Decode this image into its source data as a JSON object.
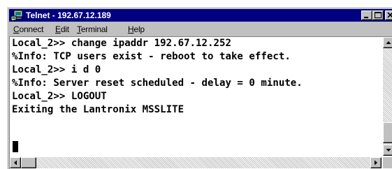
{
  "window": {
    "title": "Telnet - 192.67.12.189",
    "title_bar_color": "#000080",
    "terminal_background": "#ffffff",
    "icons": {
      "app": "telnet-computer-icon",
      "minimize": "minimize-icon",
      "maximize": "maximize-icon",
      "close": "close-icon"
    }
  },
  "menu": {
    "connect": {
      "accel": "C",
      "rest": "onnect"
    },
    "edit": {
      "accel": "E",
      "rest": "dit"
    },
    "terminal": {
      "accel": "T",
      "rest": "erminal"
    },
    "help": {
      "accel": "H",
      "rest": "elp"
    }
  },
  "terminal": {
    "lines": [
      "Local_2>> change ipaddr 192.67.12.252",
      "%Info: TCP users exist - reboot to take effect.",
      "Local_2>> i d 0",
      "%Info: Server reset scheduled - delay = 0 minute.",
      "Local_2>> LOGOUT",
      "Exiting the Lantronix MSSLITE"
    ]
  },
  "scrollbars": {
    "vertical": {
      "up": "arrow-up-icon",
      "down": "arrow-down-icon"
    },
    "horizontal": {
      "left": "arrow-left-icon",
      "right": "arrow-right-icon"
    }
  }
}
